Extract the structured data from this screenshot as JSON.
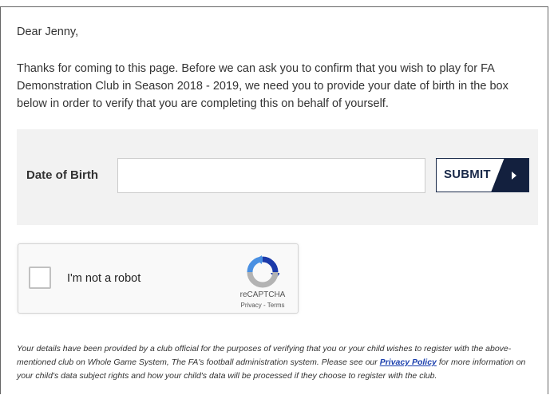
{
  "greeting": "Dear Jenny,",
  "intro_text": "Thanks for coming to this page. Before we can ask you to confirm that you wish to play for FA Demonstration Club in Season 2018 - 2019, we need you to provide your date of birth in the box below in order to verify that you are completing this on behalf of yourself.",
  "dob_form": {
    "label": "Date of Birth",
    "input_value": "",
    "submit_label": "SUBMIT"
  },
  "recaptcha": {
    "checkbox_label": "I'm not a robot",
    "brand": "reCAPTCHA",
    "privacy_link": "Privacy",
    "separator": " - ",
    "terms_link": "Terms",
    "checked": false,
    "colors": {
      "blue": "#4a90e2",
      "dark_blue": "#1c3aa9",
      "grey": "#b3b3b3"
    }
  },
  "footer": {
    "text_part1": "Your details have been provided by a club official for the purposes of verifying that you or your child wishes to register with the above-mentioned club on Whole Game System, The FA's football administration system. Please see our ",
    "privacy_policy_link": "Privacy Policy",
    "text_part2": " for more information on your child's data subject rights and how your child's data will be processed if they choose to register with the club."
  },
  "colors": {
    "panel_background": "#f2f2f2",
    "submit_navy": "#13203e",
    "link_blue": "#1a3fae"
  }
}
